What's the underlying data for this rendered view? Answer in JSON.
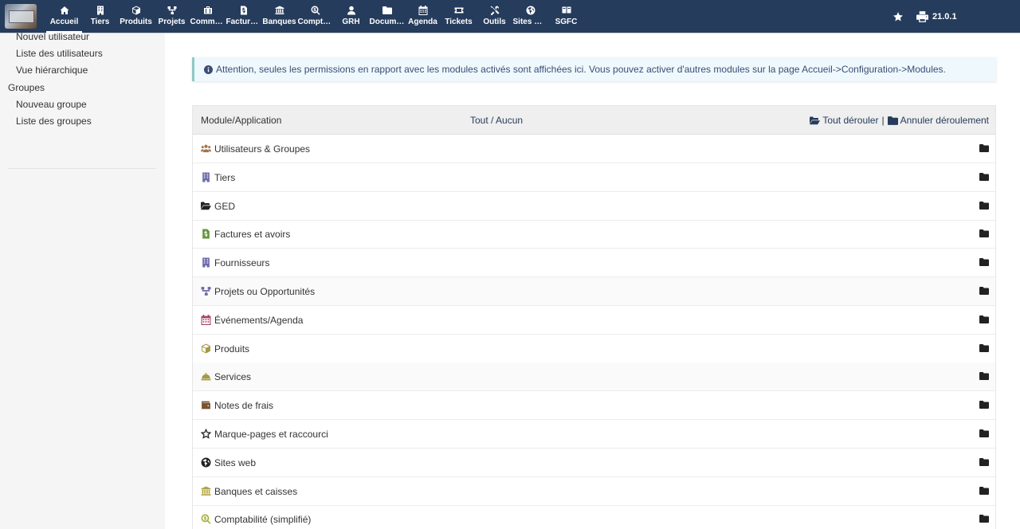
{
  "topbar": {
    "menu": [
      {
        "label": "Accueil",
        "icon": "home-icon",
        "active": true
      },
      {
        "label": "Tiers",
        "icon": "building-icon"
      },
      {
        "label": "Produits",
        "icon": "cube-icon"
      },
      {
        "label": "Projets",
        "icon": "project-icon"
      },
      {
        "label": "Commercial",
        "icon": "briefcase-icon"
      },
      {
        "label": "Facturation",
        "icon": "invoice-icon"
      },
      {
        "label": "Banques",
        "icon": "bank-icon"
      },
      {
        "label": "Comptabilité",
        "icon": "search-dollar-icon"
      },
      {
        "label": "GRH",
        "icon": "user-icon"
      },
      {
        "label": "Documents",
        "icon": "folder-icon"
      },
      {
        "label": "Agenda",
        "icon": "calendar-icon"
      },
      {
        "label": "Tickets",
        "icon": "ticket-icon"
      },
      {
        "label": "Outils",
        "icon": "tools-icon"
      },
      {
        "label": "Sites web",
        "icon": "globe-icon"
      },
      {
        "label": "SGFC",
        "icon": "sgfc-icon"
      }
    ],
    "version": "21.0.1",
    "bookmark_icon": "star-icon",
    "print_icon": "print-icon"
  },
  "leftmenu": {
    "items": [
      {
        "label": "Nouvel utilisateur",
        "level": "sub"
      },
      {
        "label": "Liste des utilisateurs",
        "level": "sub"
      },
      {
        "label": "Vue hiérarchique",
        "level": "sub"
      },
      {
        "label": "Groupes",
        "level": "top"
      },
      {
        "label": "Nouveau groupe",
        "level": "sub"
      },
      {
        "label": "Liste des groupes",
        "level": "sub"
      }
    ]
  },
  "info": {
    "text": "Attention, seules les permissions en rapport avec les modules activés sont affichées ici. Vous pouvez activer d'autres modules sur la page Accueil->Configuration->Modules."
  },
  "table": {
    "col_module": "Module/Application",
    "all": "Tout",
    "sep": " / ",
    "none": "Aucun",
    "expand_all": "Tout dérouler",
    "pipe": "|",
    "collapse_all": "Annuler déroulement",
    "rows": [
      {
        "label": "Utilisateurs & Groupes",
        "icon": "users-icon",
        "color": "#a4734b"
      },
      {
        "label": "Tiers",
        "icon": "building-icon",
        "color": "#6c6aa8"
      },
      {
        "label": "GED",
        "icon": "folder-open-icon",
        "color": "#222222"
      },
      {
        "label": "Factures et avoirs",
        "icon": "invoice-icon",
        "color": "#65953d"
      },
      {
        "label": "Fournisseurs",
        "icon": "building-icon",
        "color": "#6c6aa8"
      },
      {
        "label": "Projets ou Opportunités",
        "icon": "project-icon",
        "color": "#6c6aa8"
      },
      {
        "label": "Événements/Agenda",
        "icon": "calendar-icon",
        "color": "#a8435f"
      },
      {
        "label": "Produits",
        "icon": "cube-icon",
        "color": "#a69944"
      },
      {
        "label": "Services",
        "icon": "concierge-bell-icon",
        "color": "#a69944"
      },
      {
        "label": "Notes de frais",
        "icon": "wallet-icon",
        "color": "#795330"
      },
      {
        "label": "Marque-pages et raccourci",
        "icon": "star-outline-icon",
        "color": "#222222"
      },
      {
        "label": "Sites web",
        "icon": "globe-icon",
        "color": "#222222"
      },
      {
        "label": "Banques et caisses",
        "icon": "bank-icon",
        "color": "#b0a33e"
      },
      {
        "label": "Comptabilité (simplifié)",
        "icon": "search-dollar-icon",
        "color": "#a5b034"
      }
    ]
  }
}
